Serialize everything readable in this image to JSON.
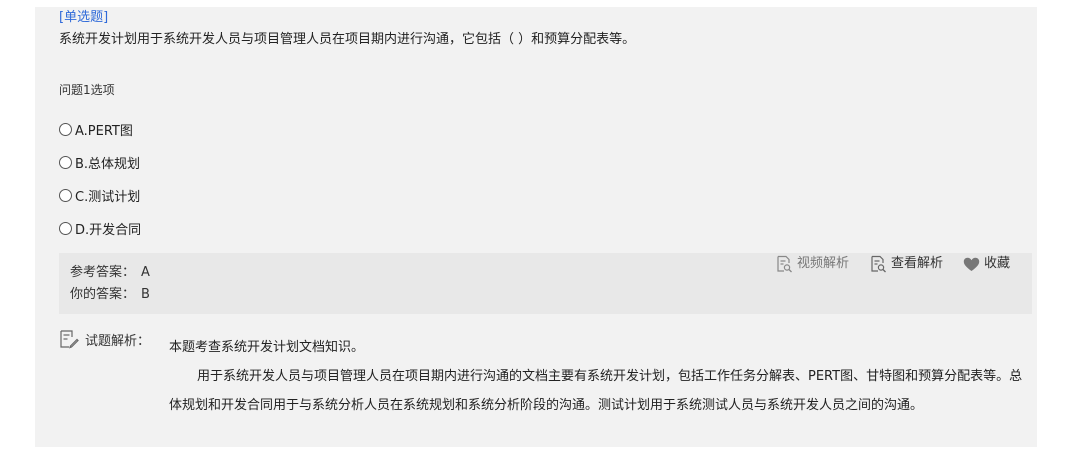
{
  "question": {
    "type_label": "[单选题]",
    "stem": "系统开发计划用于系统开发人员与项目管理人员在项目期内进行沟通，它包括（  ）和预算分配表等。",
    "options_title": "问题1选项",
    "options": [
      {
        "label": "A.PERT图"
      },
      {
        "label": "B.总体规划"
      },
      {
        "label": "C.测试计划"
      },
      {
        "label": "D.开发合同"
      }
    ]
  },
  "answer": {
    "reference_label": "参考答案：",
    "reference_value": "A",
    "yours_label": "你的答案：",
    "yours_value": "B"
  },
  "actions": {
    "video": "视频解析",
    "view": "查看解析",
    "favorite": "收藏"
  },
  "analysis": {
    "label": "试题解析：",
    "line1": "本题考查系统开发计划文档知识。",
    "paragraph": "用于系统开发人员与项目管理人员在项目期内进行沟通的文档主要有系统开发计划，包括工作任务分解表、PERT图、甘特图和预算分配表等。总体规划和开发合同用于与系统分析人员在系统规划和系统分析阶段的沟通。测试计划用于系统测试人员与系统开发人员之间的沟通。"
  },
  "colors": {
    "accent": "#2f6ad9",
    "panel_bg": "#f2f2f2",
    "answer_bg": "#e8e8e8"
  }
}
